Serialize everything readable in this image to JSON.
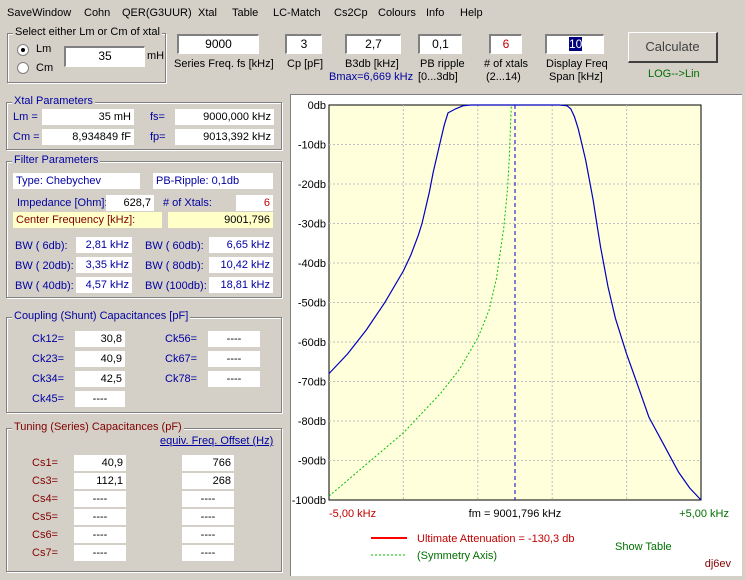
{
  "menu": [
    "SaveWindow",
    "Cohn",
    "QER(G3UUR)",
    "Xtal",
    "Table",
    "LC-Match",
    "Cs2Cp",
    "Colours",
    "Info",
    "Help"
  ],
  "select_box": {
    "title": "Select either Lm or Cm of xtal",
    "opt_lm": "Lm",
    "opt_cm": "Cm",
    "selected": "Lm",
    "value": "35",
    "unit": "mH"
  },
  "inputs": {
    "series_freq": {
      "value": "9000",
      "label": "Series Freq. fs [kHz]"
    },
    "cp": {
      "value": "3",
      "label": "Cp [pF]"
    },
    "b3db": {
      "value": "2,7",
      "label": "B3db [kHz]",
      "sub": "Bmax=6,669 kHz"
    },
    "pb_ripple": {
      "value": "0,1",
      "label": "PB ripple",
      "label2": "[0...3db]"
    },
    "num_xtals": {
      "value": "6",
      "label": "# of xtals",
      "label2": "(2...14)"
    },
    "span": {
      "value": "10",
      "label": "Display Freq",
      "label2": "Span [kHz]"
    }
  },
  "calculate_label": "Calculate",
  "log_lin_label": "LOG-->Lin",
  "xtal": {
    "title": "Xtal Parameters",
    "lm_label": "Lm =",
    "lm_value": "35 mH",
    "cm_label": "Cm =",
    "cm_value": "8,934849  fF",
    "fs_label": "fs=",
    "fs_value": "9000,000 kHz",
    "fp_label": "fp=",
    "fp_value": "9013,392 kHz"
  },
  "filter": {
    "title": "Filter Parameters",
    "type": "Type:   Chebychev",
    "ripple": "PB-Ripple: 0,1db",
    "impedance_label": "Impedance [Ohm]:",
    "impedance_value": "628,7",
    "xtals_label": "# of Xtals:",
    "xtals_value": "6",
    "center_label": "Center Frequency [kHz]:",
    "center_value": "9001,796",
    "bw": [
      {
        "label": "BW (  6db):",
        "value": "2,81 kHz"
      },
      {
        "label": "BW ( 60db):",
        "value": "6,65 kHz"
      },
      {
        "label": "BW ( 20db):",
        "value": "3,35 kHz"
      },
      {
        "label": "BW ( 80db):",
        "value": "10,42 kHz"
      },
      {
        "label": "BW ( 40db):",
        "value": "4,57 kHz"
      },
      {
        "label": "BW (100db):",
        "value": "18,81 kHz"
      }
    ]
  },
  "coupling": {
    "title": "Coupling (Shunt) Capacitances [pF]",
    "left": [
      {
        "label": "Ck12=",
        "value": "30,8"
      },
      {
        "label": "Ck23=",
        "value": "40,9"
      },
      {
        "label": "Ck34=",
        "value": "42,5"
      },
      {
        "label": "Ck45=",
        "value": "----"
      }
    ],
    "right": [
      {
        "label": "Ck56=",
        "value": "----"
      },
      {
        "label": "Ck67=",
        "value": "----"
      },
      {
        "label": "Ck78=",
        "value": "----"
      }
    ]
  },
  "tuning": {
    "title": "Tuning (Series) Capacitances (pF)",
    "offset_label": "equiv. Freq. Offset (Hz)",
    "rows": [
      {
        "label": "Cs1=",
        "value": "40,9",
        "offset": "766"
      },
      {
        "label": "Cs3=",
        "value": "112,1",
        "offset": "268"
      },
      {
        "label": "Cs4=",
        "value": "----",
        "offset": "----"
      },
      {
        "label": "Cs5=",
        "value": "----",
        "offset": "----"
      },
      {
        "label": "Cs6=",
        "value": "----",
        "offset": "----"
      },
      {
        "label": "Cs7=",
        "value": "----",
        "offset": "----"
      }
    ]
  },
  "chart_data": {
    "type": "line",
    "x_range_khz": [
      -5,
      5
    ],
    "y_range_db": [
      -100,
      0
    ],
    "ytick_labels": [
      "0db",
      "-10db",
      "-20db",
      "-30db",
      "-40db",
      "-50db",
      "-60db",
      "-70db",
      "-80db",
      "-90db",
      "-100db"
    ],
    "x_left_label": "-5,00 kHz",
    "x_center_label": "fm = 9001,796 kHz",
    "x_right_label": "+5,00 kHz",
    "grid": true,
    "colors": {
      "background": "#ffffdc",
      "response": "#0000c0",
      "symmetry": "#00c000",
      "ultimate": "#ff0000",
      "grid": "#c0c0c0"
    },
    "series": [
      {
        "x": [
          -5.0,
          -4.5,
          -4.0,
          -3.5,
          -3.0,
          -2.8,
          -2.6,
          -2.5,
          -2.4,
          -2.3,
          -2.2,
          -2.1,
          -2.0,
          -1.9,
          -1.8,
          -1.6,
          -1.4,
          -1.2,
          1.2,
          1.4,
          1.5,
          1.6,
          1.7,
          1.8,
          1.9,
          2.0,
          2.1,
          2.2,
          2.3,
          2.4,
          2.5,
          2.7,
          3.0,
          3.3,
          3.6,
          4.0,
          4.4,
          4.7,
          5.0
        ],
        "y": [
          -68,
          -63,
          -57,
          -50,
          -42,
          -38,
          -33,
          -30,
          -26,
          -22,
          -17,
          -13,
          -9,
          -5,
          -2,
          -1,
          -0.2,
          0,
          0,
          -0.2,
          -1,
          -3,
          -6,
          -10,
          -14,
          -19,
          -24,
          -30,
          -36,
          -41,
          -46,
          -54,
          -63,
          -71,
          -79,
          -86,
          -93,
          -97,
          -100
        ]
      },
      {
        "x": [
          -5.0,
          -4.5,
          -4.0,
          -3.5,
          -3.0,
          -2.5,
          -2.0,
          -1.5,
          -1.0,
          -0.7,
          -0.5,
          -0.3,
          -0.2,
          -0.15,
          -0.1
        ],
        "y": [
          -99,
          -95,
          -91,
          -87,
          -83,
          -78,
          -73,
          -67,
          -59,
          -52,
          -44,
          -31,
          -21,
          -13,
          0
        ]
      }
    ],
    "ultimate_label": "Ultimate Attenuation =  -130,3 db",
    "symmetry_label": "(Symmetry Axis)",
    "show_table_label": "Show Table",
    "signature": "dj6ev"
  }
}
